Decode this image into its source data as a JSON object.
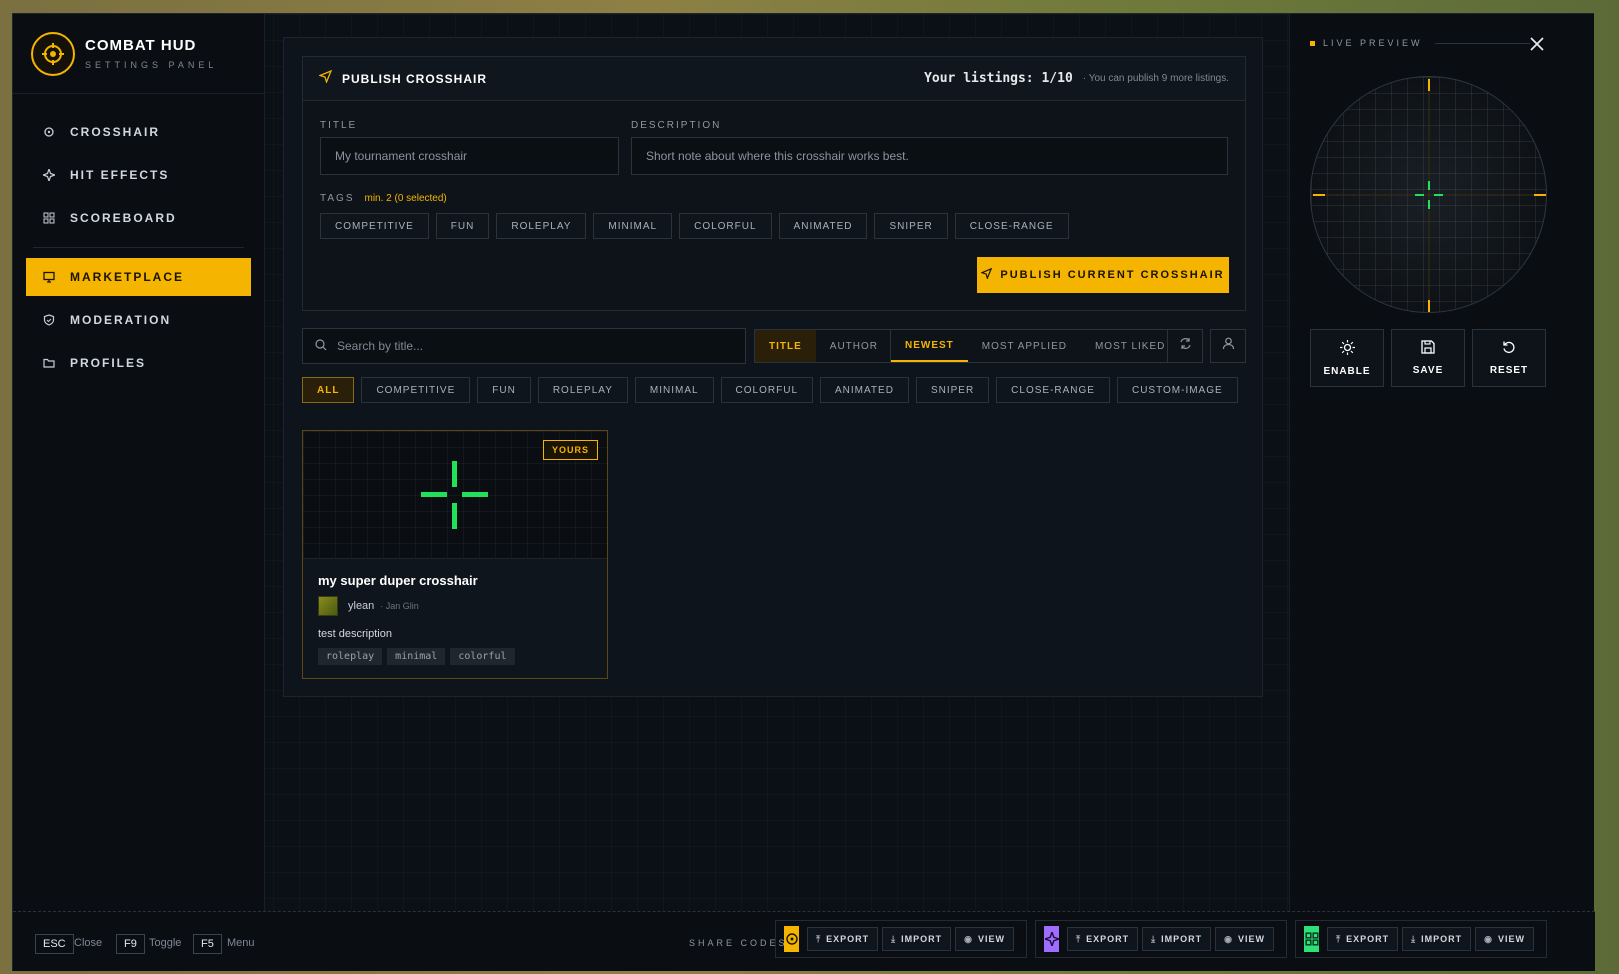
{
  "brand": {
    "title": "COMBAT HUD",
    "subtitle": "SETTINGS PANEL"
  },
  "nav": [
    {
      "label": "CROSSHAIR",
      "icon": "crosshair-icon"
    },
    {
      "label": "HIT EFFECTS",
      "icon": "sparkle-icon"
    },
    {
      "label": "SCOREBOARD",
      "icon": "grid-icon"
    },
    {
      "label": "MARKETPLACE",
      "icon": "monitor-icon",
      "active": true
    },
    {
      "label": "MODERATION",
      "icon": "shield-icon"
    },
    {
      "label": "PROFILES",
      "icon": "folder-icon"
    }
  ],
  "publish": {
    "title": "PUBLISH CROSSHAIR",
    "listings": "Your listings: 1/10",
    "listings_note": "You can publish 9 more listings.",
    "title_label": "TITLE",
    "title_placeholder": "My tournament crosshair",
    "desc_label": "DESCRIPTION",
    "desc_placeholder": "Short note about where this crosshair works best.",
    "tags_label": "TAGS",
    "tags_hint": "min. 2 (0 selected)",
    "tags": [
      "COMPETITIVE",
      "FUN",
      "ROLEPLAY",
      "MINIMAL",
      "COLORFUL",
      "ANIMATED",
      "SNIPER",
      "CLOSE-RANGE"
    ],
    "button": "PUBLISH CURRENT CROSSHAIR"
  },
  "search": {
    "placeholder": "Search by title..."
  },
  "search_by": [
    "TITLE",
    "AUTHOR"
  ],
  "sort": [
    "NEWEST",
    "MOST APPLIED",
    "MOST LIKED"
  ],
  "filters": [
    "ALL",
    "COMPETITIVE",
    "FUN",
    "ROLEPLAY",
    "MINIMAL",
    "COLORFUL",
    "ANIMATED",
    "SNIPER",
    "CLOSE-RANGE",
    "CUSTOM-IMAGE"
  ],
  "card": {
    "badge": "YOURS",
    "title": "my super duper crosshair",
    "author": "ylean",
    "date": "Jan Glin",
    "description": "test description",
    "tags": [
      "roleplay",
      "minimal",
      "colorful"
    ]
  },
  "preview": {
    "label": "LIVE PREVIEW"
  },
  "actions": [
    "ENABLE",
    "SAVE",
    "RESET"
  ],
  "footer": {
    "keys": [
      {
        "key": "ESC",
        "label": "Close"
      },
      {
        "key": "F9",
        "label": "Toggle"
      },
      {
        "key": "F5",
        "label": "Menu"
      }
    ],
    "share_label": "SHARE CODES",
    "share_buttons": [
      "EXPORT",
      "IMPORT",
      "VIEW"
    ]
  },
  "colors": {
    "accent": "#f5b400",
    "crosshair": "#22e05a",
    "purple": "#a06bff",
    "green": "#2ee07a"
  }
}
